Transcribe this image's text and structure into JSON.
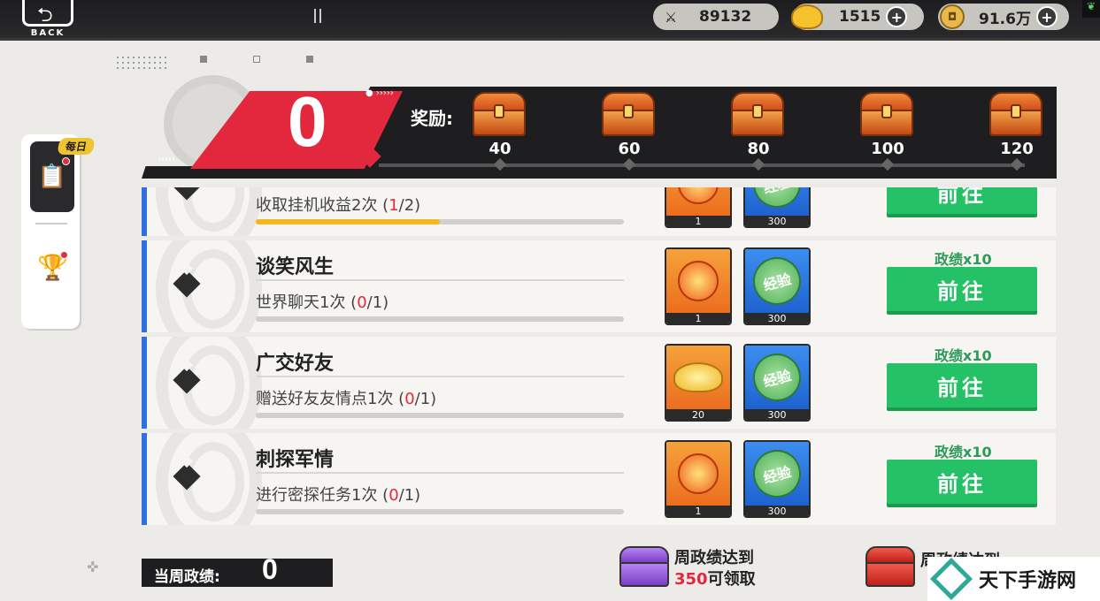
{
  "topbar": {
    "back_label": "BACK",
    "currency": [
      {
        "icon": "crossed-swords-icon",
        "value": "89132",
        "has_plus": false
      },
      {
        "icon": "gold-ingot-icon",
        "value": "1515",
        "has_plus": true
      },
      {
        "icon": "copper-coin-icon",
        "value": "91.6万",
        "has_plus": true
      }
    ]
  },
  "sidebar": {
    "daily_badge": "每日",
    "tabs": [
      {
        "icon": "clipboard-icon",
        "active": true
      },
      {
        "icon": "trophy-icon",
        "active": false
      }
    ]
  },
  "progress": {
    "score": "0",
    "reward_label": "奖励:",
    "milestones": [
      "40",
      "60",
      "80",
      "100",
      "120"
    ]
  },
  "tasks": [
    {
      "name": "",
      "desc_prefix": "收取挂机收益2次 (",
      "current": "1",
      "desc_suffix": "/2)",
      "progress": 0.5,
      "items": [
        {
          "type": "fire",
          "count": "1"
        },
        {
          "type": "exp",
          "count": "300"
        }
      ],
      "reward": "",
      "button": "前往"
    },
    {
      "name": "谈笑风生",
      "desc_prefix": "世界聊天1次 (",
      "current": "0",
      "desc_suffix": "/1)",
      "progress": 0,
      "items": [
        {
          "type": "fire",
          "count": "1"
        },
        {
          "type": "exp",
          "count": "300"
        }
      ],
      "reward": "政绩x10",
      "button": "前往"
    },
    {
      "name": "广交好友",
      "desc_prefix": "赠送好友友情点1次 (",
      "current": "0",
      "desc_suffix": "/1)",
      "progress": 0,
      "items": [
        {
          "type": "ingot",
          "count": "20"
        },
        {
          "type": "exp",
          "count": "300"
        }
      ],
      "reward": "政绩x10",
      "button": "前往"
    },
    {
      "name": "刺探军情",
      "desc_prefix": "进行密探任务1次 (",
      "current": "0",
      "desc_suffix": "/1)",
      "progress": 0,
      "items": [
        {
          "type": "fire",
          "count": "1"
        },
        {
          "type": "exp",
          "count": "300"
        }
      ],
      "reward": "政绩x10",
      "button": "前往"
    }
  ],
  "exp_label": "经验",
  "bottom": {
    "week_label": "当周政绩:",
    "week_value": "0",
    "weekly_line1": "周政绩达到",
    "weekly_num": "350",
    "weekly_line2": "可领取",
    "weekly2_line1": "周政绩达到"
  },
  "watermark": "天下手游网"
}
